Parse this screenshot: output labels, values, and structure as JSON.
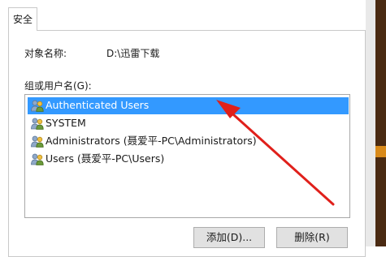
{
  "tab": {
    "label": "安全"
  },
  "object": {
    "label": "对象名称:",
    "value": "D:\\迅雷下载"
  },
  "group": {
    "label": "组或用户名(G):"
  },
  "users": [
    {
      "name": "Authenticated Users",
      "selected": true
    },
    {
      "name": "SYSTEM",
      "selected": false
    },
    {
      "name": "Administrators (聂爱平-PC\\Administrators)",
      "selected": false
    },
    {
      "name": "Users (聂爱平-PC\\Users)",
      "selected": false
    }
  ],
  "buttons": {
    "add": "添加(D)...",
    "remove": "删除(R)"
  },
  "colors": {
    "selection": "#3399ff",
    "arrow": "#e0201b"
  }
}
